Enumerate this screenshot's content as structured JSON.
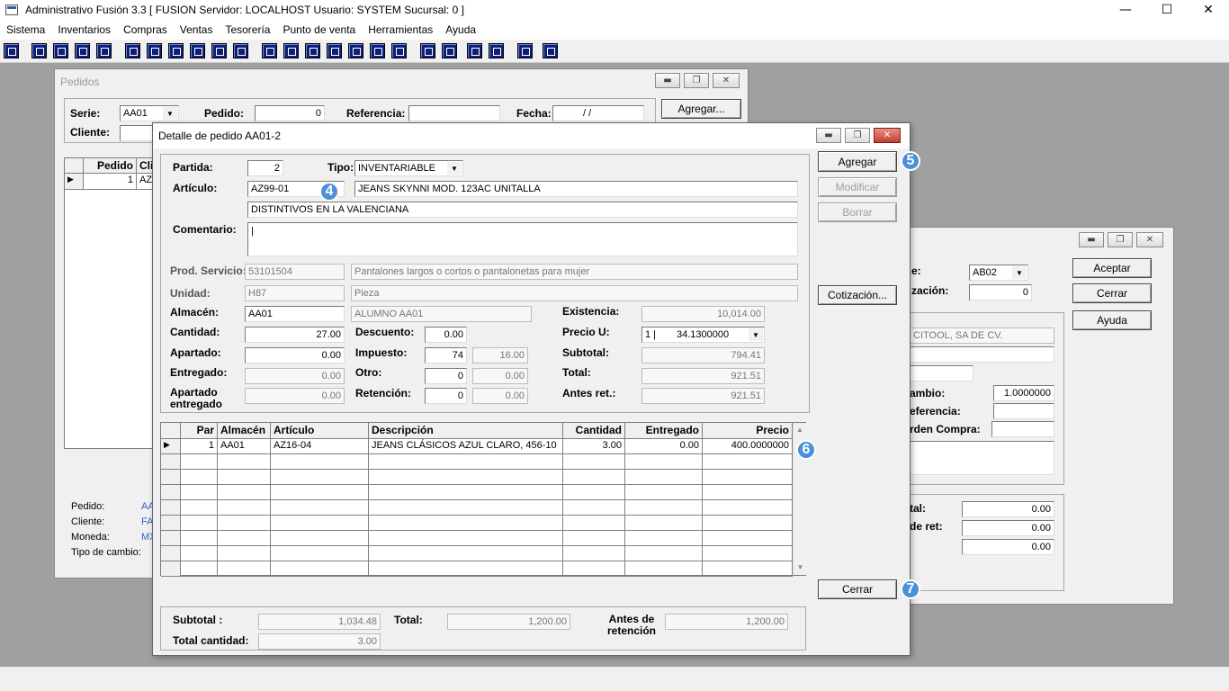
{
  "app": {
    "title": "Administrativo Fusión 3.3 [ FUSION   Servidor: LOCALHOST   Usuario: SYSTEM     Sucursal: 0 ]",
    "minimize": "—",
    "maximize": "☐",
    "close": "✕"
  },
  "menu": [
    "Sistema",
    "Inventarios",
    "Compras",
    "Ventas",
    "Tesorería",
    "Punto de venta",
    "Herramientas",
    "Ayuda"
  ],
  "pedidos": {
    "title": "Pedidos",
    "serie_label": "Serie:",
    "serie_value": "AA01",
    "pedido_label": "Pedido:",
    "pedido_value": "0",
    "referencia_label": "Referencia:",
    "fecha_label": "Fecha:",
    "fecha_value": "/ /",
    "agregar_btn": "Agregar...",
    "cliente_label": "Cliente:",
    "grid_head_pedido": "Pedido",
    "grid_head_cli": "Cli",
    "grid_row_pedido": "1",
    "grid_row_cli": "AZ",
    "info_pedido": "Pedido:",
    "info_pedido_val": "AA",
    "info_cliente": "Cliente:",
    "info_cliente_val": "FA",
    "info_moneda": "Moneda:",
    "info_moneda_val": "MX",
    "info_tipo": "Tipo de cambio:"
  },
  "back_window": {
    "serie_label_frag": "e:",
    "serie_value": "AB02",
    "zacion_label": "zación:",
    "zacion_value": "0",
    "aceptar": "Aceptar",
    "cerrar": "Cerrar",
    "ayuda": "Ayuda",
    "cliente_name": "CITOOL, SA DE CV.",
    "cambio_label": "ambio:",
    "cambio_value": "1.0000000",
    "referencia_label": "eferencia:",
    "orden_label": "rden Compra:",
    "tal_label": "tal:",
    "tal_value": "0.00",
    "deret_label": "de ret:",
    "deret_value": "0.00",
    "third_value": "0.00"
  },
  "detalle": {
    "title": "Detalle de pedido AA01-2",
    "partida_label": "Partida:",
    "partida_value": "2",
    "tipo_label": "Tipo:",
    "tipo_value": "INVENTARIABLE",
    "articulo_label": "Artículo:",
    "articulo_value": "AZ99-01",
    "articulo_desc": "JEANS SKYNNI MOD. 123AC  UNITALLA",
    "articulo_desc2": "DISTINTIVOS EN LA VALENCIANA",
    "comentario_label": "Comentario:",
    "comentario_value": "|",
    "prodserv_label": "Prod. Servicio:",
    "prodserv_code": "53101504",
    "prodserv_desc": "Pantalones largos o cortos o pantalonetas para mujer",
    "unidad_label": "Unidad:",
    "unidad_code": "H87",
    "unidad_desc": "Pieza",
    "almacen_label": "Almacén:",
    "almacen_code": "AA01",
    "almacen_desc": "ALUMNO AA01",
    "existencia_label": "Existencia:",
    "existencia_value": "10,014.00",
    "cantidad_label": "Cantidad:",
    "cantidad_value": "27.00",
    "descuento_label": "Descuento:",
    "descuento_value": "0.00",
    "preciou_label": "Precio U:",
    "preciou_prefix": "1 |",
    "preciou_value": "34.1300000",
    "apartado_label": "Apartado:",
    "apartado_value": "0.00",
    "impuesto_label": "Impuesto:",
    "impuesto_code": "74",
    "impuesto_value": "16.00",
    "subtotal_label": "Subtotal:",
    "subtotal_value": "794.41",
    "entregado_label": "Entregado:",
    "entregado_value": "0.00",
    "otro_label": "Otro:",
    "otro_code": "0",
    "otro_value": "0.00",
    "total_label": "Total:",
    "total_value": "921.51",
    "apent_label1": "Apartado",
    "apent_label2": "entregado",
    "apent_value": "0.00",
    "retencion_label": "Retención:",
    "retencion_code": "0",
    "retencion_value": "0.00",
    "antesret_label": "Antes ret.:",
    "antesret_value": "921.51",
    "btn_agregar": "Agregar",
    "btn_modificar": "Modificar",
    "btn_borrar": "Borrar",
    "btn_cotizacion": "Cotización...",
    "btn_cerrar": "Cerrar",
    "badge4": "4",
    "badge5": "5",
    "badge6": "6",
    "badge7": "7",
    "grid": {
      "headers": [
        "Par",
        "Almacén",
        "Artículo",
        "Descripción",
        "Cantidad",
        "Entregado",
        "Precio"
      ],
      "rows": [
        [
          "1",
          "AA01",
          "AZ16-04",
          "JEANS CLÁSICOS AZUL CLARO, 456-10",
          "3.00",
          "0.00",
          "400.0000000"
        ]
      ]
    },
    "footer": {
      "subtotal_label": "Subtotal :",
      "subtotal_value": "1,034.48",
      "total_label": "Total:",
      "total_value": "1,200.00",
      "antes_label1": "Antes de",
      "antes_label2": "retención",
      "antes_value": "1,200.00",
      "totalcant_label": "Total cantidad:",
      "totalcant_value": "3.00"
    }
  }
}
